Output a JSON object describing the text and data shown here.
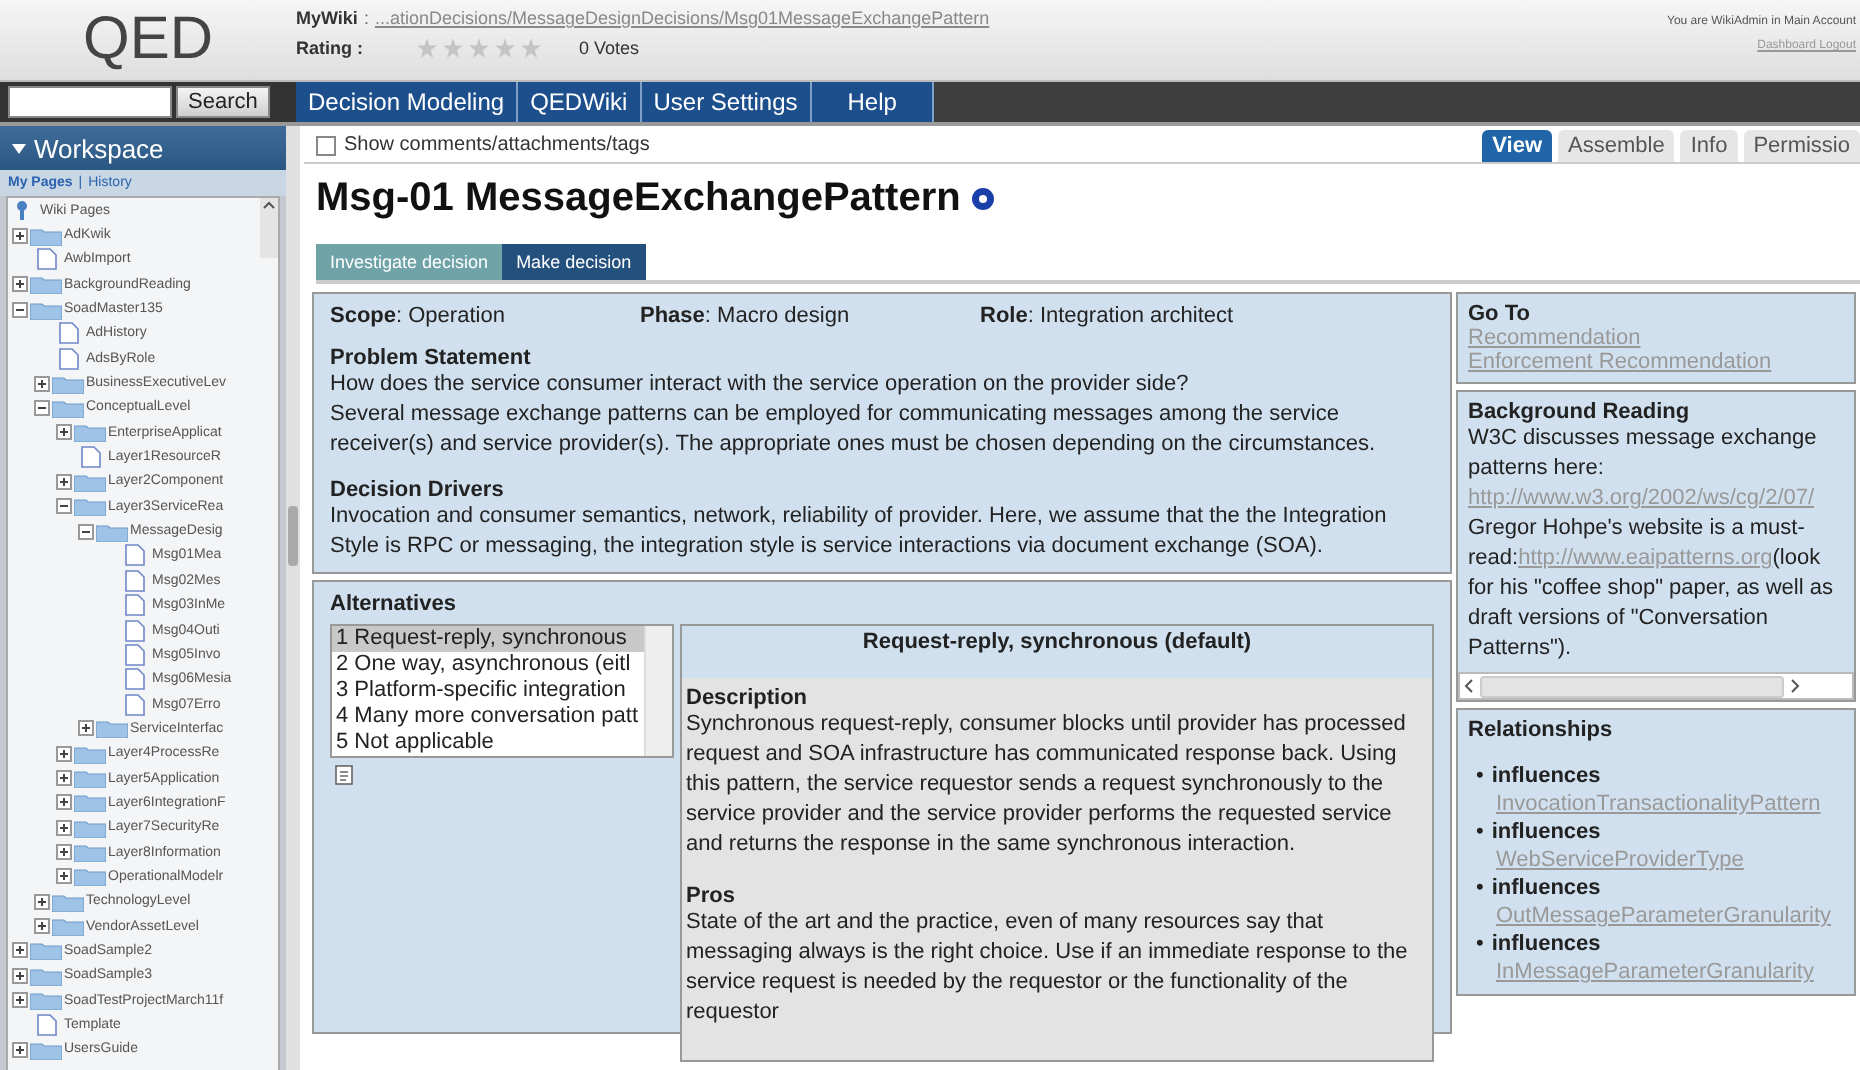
{
  "header": {
    "logo": "QED",
    "breadcrumb_label": "MyWiki",
    "breadcrumb_sep": ":",
    "breadcrumb": "...ationDecisions/MessageDesignDecisions/Msg01MessageExchangePattern",
    "rating_label": "Rating :",
    "stars": 0,
    "votes": "0 Votes",
    "user_info": "You are WikiAdmin in Main Account",
    "user_links": "Dashboard Logout"
  },
  "search": {
    "button": "Search"
  },
  "nav": [
    {
      "label": "Decision Modeling"
    },
    {
      "label": "QEDWiki"
    },
    {
      "label": "User Settings"
    },
    {
      "label": "Help"
    }
  ],
  "sidebar": {
    "title": "Workspace",
    "links": [
      "My Pages",
      "History"
    ],
    "links_separator": "|",
    "tree": {
      "label": "Wiki Pages",
      "children": [
        {
          "label": "AdKwik",
          "kind": "folder",
          "expanded": false
        },
        {
          "label": "AwbImport",
          "kind": "page"
        },
        {
          "label": "BackgroundReading",
          "kind": "folder",
          "expanded": false
        },
        {
          "label": "SoadMaster135",
          "kind": "folder",
          "expanded": true,
          "children": [
            {
              "label": "AdHistory",
              "kind": "page"
            },
            {
              "label": "AdsByRole",
              "kind": "page"
            },
            {
              "label": "BusinessExecutiveLev",
              "kind": "folder",
              "expanded": false
            },
            {
              "label": "ConceptualLevel",
              "kind": "folder",
              "expanded": true,
              "children": [
                {
                  "label": "EnterpriseApplicat",
                  "kind": "folder",
                  "expanded": false
                },
                {
                  "label": "Layer1ResourceR",
                  "kind": "page"
                },
                {
                  "label": "Layer2Component",
                  "kind": "folder",
                  "expanded": false
                },
                {
                  "label": "Layer3ServiceRea",
                  "kind": "folder",
                  "expanded": true,
                  "children": [
                    {
                      "label": "MessageDesig",
                      "kind": "folder",
                      "expanded": true,
                      "children": [
                        {
                          "label": "Msg01Mea",
                          "kind": "page"
                        },
                        {
                          "label": "Msg02Mes",
                          "kind": "page"
                        },
                        {
                          "label": "Msg03InMe",
                          "kind": "page"
                        },
                        {
                          "label": "Msg04Outi",
                          "kind": "page"
                        },
                        {
                          "label": "Msg05Invo",
                          "kind": "page"
                        },
                        {
                          "label": "Msg06Mesia",
                          "kind": "page"
                        },
                        {
                          "label": "Msg07Erro",
                          "kind": "page"
                        }
                      ]
                    },
                    {
                      "label": "ServiceInterfac",
                      "kind": "folder",
                      "expanded": false
                    }
                  ]
                },
                {
                  "label": "Layer4ProcessRe",
                  "kind": "folder",
                  "expanded": false
                },
                {
                  "label": "Layer5Application",
                  "kind": "folder",
                  "expanded": false
                },
                {
                  "label": "Layer6IntegrationF",
                  "kind": "folder",
                  "expanded": false
                },
                {
                  "label": "Layer7SecurityRe",
                  "kind": "folder",
                  "expanded": false
                },
                {
                  "label": "Layer8Information",
                  "kind": "folder",
                  "expanded": false
                },
                {
                  "label": "OperationalModelr",
                  "kind": "folder",
                  "expanded": false
                }
              ]
            },
            {
              "label": "TechnologyLevel",
              "kind": "folder",
              "expanded": false
            },
            {
              "label": "VendorAssetLevel",
              "kind": "folder",
              "expanded": false
            }
          ]
        },
        {
          "label": "SoadSample2",
          "kind": "folder",
          "expanded": false
        },
        {
          "label": "SoadSample3",
          "kind": "folder",
          "expanded": false
        },
        {
          "label": "SoadTestProjectMarch11f",
          "kind": "folder",
          "expanded": false
        },
        {
          "label": "Template",
          "kind": "page"
        },
        {
          "label": "UsersGuide",
          "kind": "folder",
          "expanded": false
        }
      ]
    }
  },
  "page": {
    "show_comments": {
      "label": "Show comments/attachments/tags",
      "checked": false
    },
    "view_tabs": [
      {
        "label": "View",
        "selected": true
      },
      {
        "label": "Assemble",
        "selected": false
      },
      {
        "label": "Info",
        "selected": false
      },
      {
        "label": "Permissio",
        "selected": false
      }
    ],
    "title": "Msg-01 MessageExchangePattern",
    "decision_tabs": [
      {
        "label": "Investigate decision",
        "selected": true
      },
      {
        "label": "Make decision",
        "selected": false
      }
    ],
    "meta": [
      "**Scope**: Operation",
      "**Phase**: Macro design",
      "**Role**: Integration architect"
    ],
    "sections": [
      {
        "heading": "Problem Statement",
        "paragraphs": [
          "How does the service consumer interact with the service operation on the provider side?",
          "Several message exchange patterns can be employed for communicating messages among the service receiver(s) and service provider(s). The appropriate ones must be chosen depending on the circumstances."
        ]
      },
      {
        "heading": "Decision Drivers",
        "paragraphs": [
          "Invocation and consumer semantics, network, reliability of provider. Here, we assume that the the Integration Style is RPC or messaging, the integration style is service interactions via document exchange (SOA)."
        ]
      }
    ],
    "alternatives": {
      "heading": "Alternatives",
      "items": [
        {
          "label": "1 Request-reply, synchronous",
          "selected": true
        },
        {
          "label": "2 One way, asynchronous (eitl",
          "selected": false
        },
        {
          "label": "3 Platform-specific integration",
          "selected": false
        },
        {
          "label": "4 Many more conversation patt",
          "selected": false
        },
        {
          "label": "5 Not applicable",
          "selected": false
        }
      ],
      "detail_title": "Request-reply, synchronous (default)",
      "detail_sections": [
        {
          "heading": "Description",
          "text": "Synchronous request-reply, consumer blocks until provider has processed request and SOA infrastructure has communicated response back. Using this pattern, the service requestor sends a request synchronously to the service provider and the service provider performs the requested service and returns the response in the same synchronous interaction."
        },
        {
          "heading": "Pros",
          "text": "State of the art and the practice, even of many resources say that messaging always is the right choice. Use if an immediate response to the service request is needed by the requestor or the functionality of the requestor"
        }
      ]
    },
    "goto": {
      "heading": "Go To",
      "links": [
        "Recommendation",
        "Enforcement Recommendation"
      ]
    },
    "background": {
      "heading": "Background Reading",
      "paragraphs": [
        {
          "parts": [
            {
              "kind": "text",
              "text": "W3C discusses message exchange patterns here:"
            },
            {
              "kind": "link",
              "text": "http://www.w3.org/2002/ws/cg/2/07/"
            }
          ]
        },
        {
          "parts": [
            {
              "kind": "text",
              "text": "Gregor Hohpe's website is a must-read:"
            },
            {
              "kind": "link",
              "text": "http://www.eaipatterns.org"
            },
            {
              "kind": "text",
              "text": "(look for his \"coffee shop\" paper, as well as draft versions of \"Conversation Patterns\")."
            }
          ]
        }
      ]
    },
    "relationships": {
      "heading": "Relationships",
      "marker": "•",
      "items": [
        {
          "type": "influences",
          "target": "InvocationTransactionalityPattern"
        },
        {
          "type": "influences",
          "target": "WebServiceProviderType"
        },
        {
          "type": "influences",
          "target": "OutMessageParameterGranularity"
        },
        {
          "type": "influences",
          "target": "InMessageParameterGranularity"
        }
      ]
    }
  }
}
